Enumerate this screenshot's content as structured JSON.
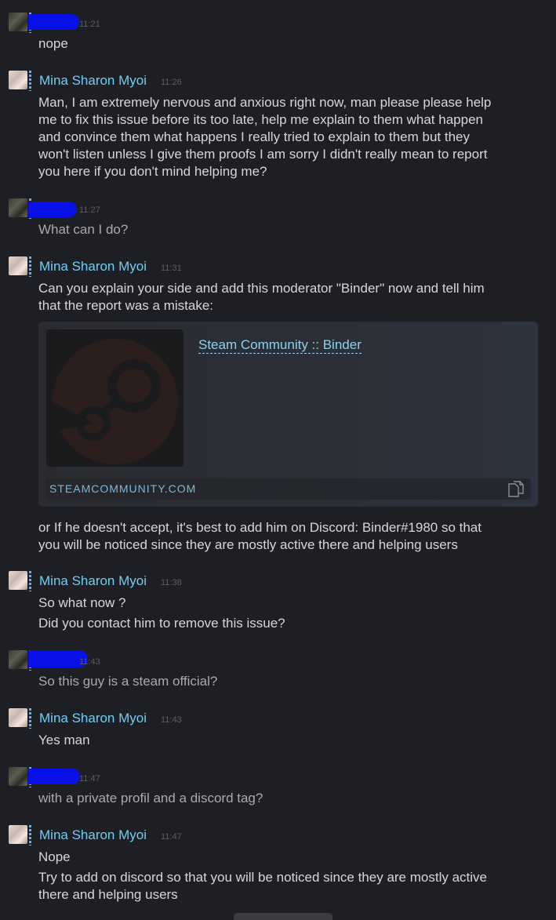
{
  "messages": [
    {
      "sender": "",
      "time": "11:21",
      "lines": [
        "nope"
      ]
    },
    {
      "sender": "Mina Sharon Myoi",
      "time": "11:26",
      "lines": [
        "Man, I am extremely nervous and anxious right now, man please please help",
        "me to fix this issue before its too late, help me explain to them what happen",
        "and convince them what happens I really tried to explain to them but they",
        "won't listen unless I give them proofs I am sorry I didn't really mean to report",
        "you here if you don't mind helping me?"
      ]
    },
    {
      "sender": "",
      "time": "11:27",
      "lines": [
        "What can I do?"
      ]
    },
    {
      "sender": "Mina Sharon Myoi",
      "time": "11:31",
      "lines": [
        "Can you explain your side and add this moderator \"Binder\" now and tell him",
        "that the report was a mistake:"
      ],
      "after_embed_lines": [
        "or If he doesn't accept, it's best to add him on Discord: Binder#1980 so that",
        "you will be noticed since they are mostly active there and helping users"
      ]
    },
    {
      "sender": "Mina Sharon Myoi",
      "time": "11:38",
      "lines": [
        "So what now ?",
        "Did you contact him to remove this issue?"
      ]
    },
    {
      "sender": "",
      "time": "11:43",
      "lines": [
        "So this guy is a steam official?"
      ]
    },
    {
      "sender": "Mina Sharon Myoi",
      "time": "11:43",
      "lines": [
        "Yes man"
      ]
    },
    {
      "sender": "",
      "time": "11:47",
      "lines": [
        "with a private profil and a discord tag?"
      ]
    },
    {
      "sender": "Mina Sharon Myoi",
      "time": "11:47",
      "lines": [
        "Nope",
        "Try to add on discord so that you will be noticed since they are mostly active",
        "there and helping users"
      ]
    }
  ],
  "embed": {
    "title": "Steam Community :: Binder",
    "domain": "STEAMCOMMUNITY.COM",
    "thumbnail_icon": "steam-logo-icon",
    "action_icon": "copy-link-icon"
  },
  "colors": {
    "background": "#1e1f24",
    "sender_name": "#6dcff6",
    "timestamp": "#5b5d62",
    "text": "#d6d7d9",
    "redaction": "#0a10e8",
    "link": "#8fd0f0"
  }
}
